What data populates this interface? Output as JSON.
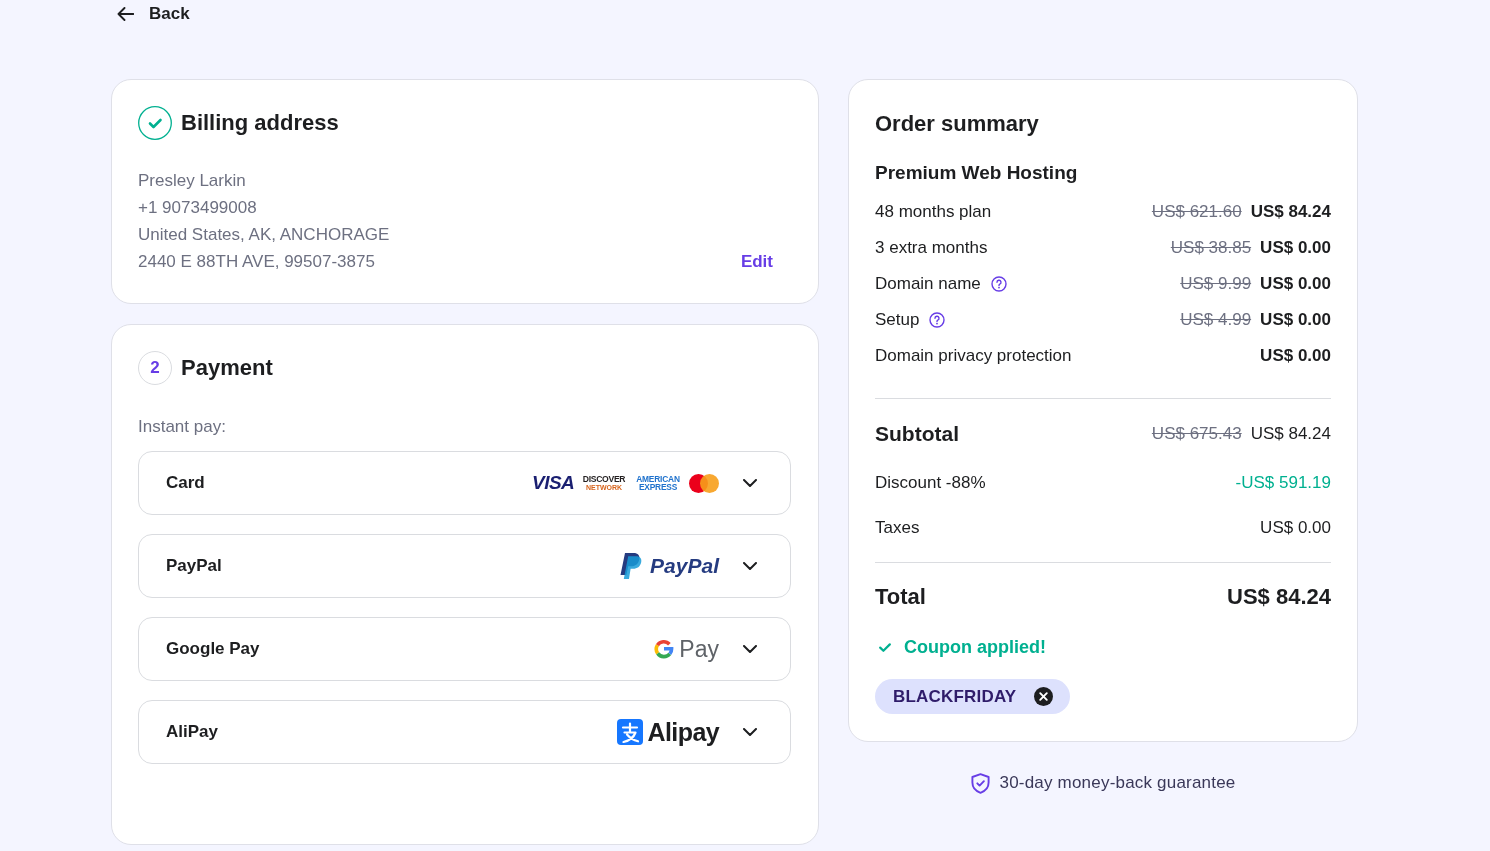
{
  "back_link": {
    "label": "Back"
  },
  "billing_address": {
    "completed": true,
    "title": "Billing address",
    "lines": [
      "Presley Larkin",
      "+1 9073499008",
      "United States, AK, ANCHORAGE",
      "2440 E 88TH AVE, 99507-3875"
    ],
    "edit_label": "Edit"
  },
  "payment": {
    "completed": false,
    "step": "2",
    "title": "Payment",
    "instant_pay_label": "Instant pay:",
    "methods": [
      {
        "kind": "card",
        "label": "Card",
        "expanded": false,
        "logos": [
          {
            "kind": "visa",
            "lines": [
              "VISA"
            ]
          },
          {
            "kind": "discover",
            "lines": [
              "DISCOVER",
              "NETWORK"
            ]
          },
          {
            "kind": "amex",
            "lines": [
              "AMERICAN",
              "EXPRESS"
            ]
          },
          {
            "kind": "mastercard"
          }
        ]
      },
      {
        "kind": "paypal",
        "label": "PayPal",
        "expanded": false,
        "logo_text": "PayPal"
      },
      {
        "kind": "google_pay",
        "label": "Google Pay",
        "expanded": false,
        "logo_text": "Pay"
      },
      {
        "kind": "alipay",
        "label": "AliPay",
        "expanded": false,
        "logo_text": "Alipay"
      }
    ]
  },
  "order_summary": {
    "title": "Order summary",
    "product": "Premium Web Hosting",
    "items": [
      {
        "label": "48 months plan",
        "help": false,
        "old_price": "US$ 621.60",
        "price": "US$ 84.24"
      },
      {
        "label": "3 extra months",
        "help": false,
        "old_price": "US$ 38.85",
        "price": "US$ 0.00"
      },
      {
        "label": "Domain name",
        "help": true,
        "old_price": "US$ 9.99",
        "price": "US$ 0.00"
      },
      {
        "label": "Setup",
        "help": true,
        "old_price": "US$ 4.99",
        "price": "US$ 0.00"
      },
      {
        "label": "Domain privacy protection",
        "help": false,
        "price": "US$ 0.00"
      }
    ],
    "subtotal": {
      "label": "Subtotal",
      "old_price": "US$ 675.43",
      "price": "US$ 84.24"
    },
    "discount": {
      "label": "Discount -88%",
      "value": "-US$ 591.19"
    },
    "taxes": {
      "label": "Taxes",
      "value": "US$ 0.00"
    },
    "total": {
      "label": "Total",
      "value": "US$ 84.24"
    },
    "coupon": {
      "applied": true,
      "status": "Coupon applied!",
      "code": "BLACKFRIDAY"
    }
  },
  "guarantee": "30-day money-back guarantee"
}
